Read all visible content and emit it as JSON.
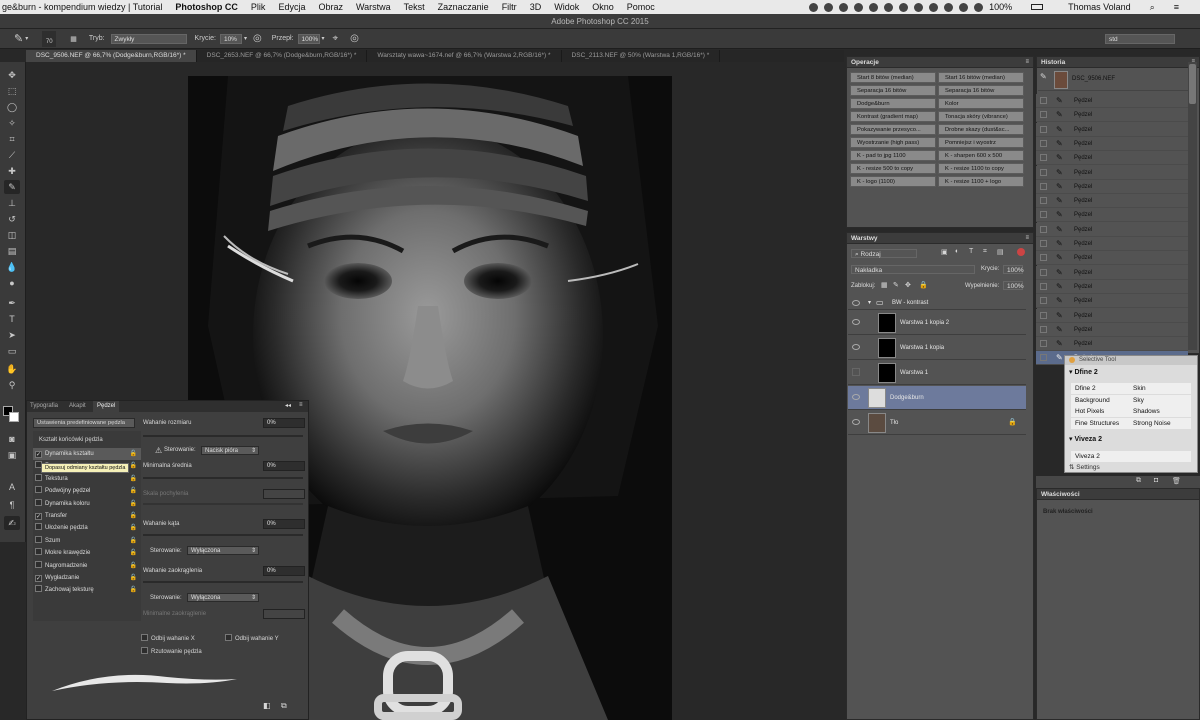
{
  "menubar": {
    "app_title": "ge&burn - kompendium wiedzy | Tutorial",
    "items": [
      "Photoshop CC",
      "Plik",
      "Edycja",
      "Obraz",
      "Warstwa",
      "Tekst",
      "Zaznaczanie",
      "Filtr",
      "3D",
      "Widok",
      "Okno",
      "Pomoc"
    ],
    "battery": "100%",
    "user": "Thomas Voland"
  },
  "window_title": "Adobe Photoshop CC 2015",
  "options": {
    "brush_size": "70",
    "mode_label": "Tryb:",
    "mode_value": "Zwykły",
    "opacity_label": "Krycie:",
    "opacity_value": "10%",
    "flow_label": "Przepł:",
    "flow_value": "100%",
    "workspace": "std"
  },
  "doc_tabs": [
    "DSC_9506.NEF @ 66,7% (Dodge&burn,RGB/16*) *",
    "DSC_2653.NEF @ 66,7% (Dodge&burn,RGB/16*) *",
    "Warsztaty wawa~1674.nef @ 66,7% (Warstwa 2,RGB/16*) *",
    "DSC_2113.NEF @ 50% (Warstwa 1,RGB/16*) *"
  ],
  "actions": {
    "title": "Operacje",
    "left": [
      "Start 8 bitów (median)",
      "Separacja 16 bitów",
      "Dodge&burn",
      "Kontrast (gradient map)",
      "Pokazywanie przesyco...",
      "Wyostrzanie (high pass)",
      "K - pad to jpg 1100",
      "K - resize 500 to copy",
      "K - logo (1100)"
    ],
    "right": [
      "Start 16 bitów (median)",
      "Separacja 16 bitów",
      "Kolor",
      "Tonacja skóry (vibrance)",
      "Drobne skazy (dust&sc...",
      "Pomniejsz i wyostrz",
      "K - sharpen 600 x 500",
      "K - resize 1100 to copy",
      "K - resize 1100 + logo"
    ]
  },
  "history": {
    "title": "Historia",
    "snapshot": "DSC_9506.NEF",
    "step_label": "Pędzel",
    "step_count": 19
  },
  "layers": {
    "title": "Warstwy",
    "filter": "Rodzaj",
    "blend_mode": "Nakładka",
    "opacity_label": "Krycie:",
    "opacity_value": "100%",
    "lock_label": "Zablokuj:",
    "fill_label": "Wypełnienie:",
    "fill_value": "100%",
    "items": [
      "BW - kontrast",
      "Warstwa 1 kopia 2",
      "Warstwa 1 kopia",
      "Warstwa 1",
      "Dodge&burn",
      "Tło"
    ]
  },
  "selective_tool": {
    "title": "Selective Tool",
    "group1": "Dfine 2",
    "rows": [
      [
        "Dfine 2",
        "Skin"
      ],
      [
        "Background",
        "Sky"
      ],
      [
        "Hot Pixels",
        "Shadows"
      ],
      [
        "Fine Structures",
        "Strong Noise"
      ]
    ],
    "group2": "Viveza 2",
    "row2": "Viveza 2",
    "settings": "Settings"
  },
  "properties": {
    "title": "Właściwości",
    "empty": "Brak właściwości"
  },
  "brush_panel": {
    "tabs": [
      "Typografia",
      "Akapit",
      "Pędzel"
    ],
    "preset_button": "Ustawienia predefiniowane pędzla",
    "tip_shape": "Kształt końcówki pędzla",
    "tooltip": "Dopasuj odmiany kształtu pędzla",
    "options": [
      {
        "label": "Dynamika kształtu",
        "checked": true
      },
      {
        "label": "Rozpraszanie",
        "checked": false
      },
      {
        "label": "Tekstura",
        "checked": false
      },
      {
        "label": "Podwójny pędzel",
        "checked": false
      },
      {
        "label": "Dynamika koloru",
        "checked": false
      },
      {
        "label": "Transfer",
        "checked": true
      },
      {
        "label": "Ułożenie pędzla",
        "checked": false
      },
      {
        "label": "Szum",
        "checked": false
      },
      {
        "label": "Mokre krawędzie",
        "checked": false
      },
      {
        "label": "Nagromadzenie",
        "checked": false
      },
      {
        "label": "Wygładzanie",
        "checked": true
      },
      {
        "label": "Zachowaj teksturę",
        "checked": false
      }
    ],
    "size_jitter": "Wahanie rozmiaru",
    "size_jitter_val": "0%",
    "control_label": "Sterowanie:",
    "control_size": "Nacisk pióra",
    "min_diameter": "Minimalna średnia",
    "min_diameter_val": "0%",
    "tilt_scale": "Skala pochylenia",
    "angle_jitter": "Wahanie kąta",
    "angle_jitter_val": "0%",
    "control_off": "Wyłączona",
    "round_jitter": "Wahanie zaokrąglenia",
    "round_jitter_val": "0%",
    "min_round": "Minimalne zaokrąglenie",
    "flip_x": "Odbij wahanie X",
    "flip_y": "Odbij wahanie Y",
    "projection": "Rzutowanie pędzla"
  }
}
